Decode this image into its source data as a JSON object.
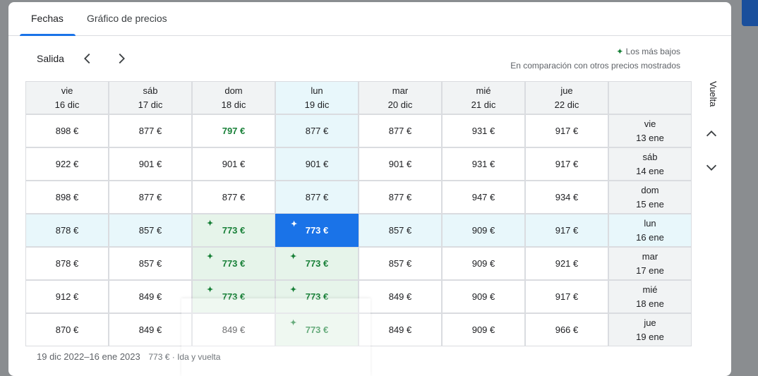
{
  "tabs": [
    {
      "label": "Fechas",
      "active": true
    },
    {
      "label": "Gráfico de precios",
      "active": false
    }
  ],
  "nav": {
    "salida_label": "Salida"
  },
  "legend": {
    "spark": "✦",
    "lowest_label": "Los más bajos",
    "comparison_text": "En comparación con otros precios mostrados"
  },
  "vuelta_label": "Vuelta",
  "columns": [
    {
      "day": "vie",
      "date": "16 dic"
    },
    {
      "day": "sáb",
      "date": "17 dic"
    },
    {
      "day": "dom",
      "date": "18 dic"
    },
    {
      "day": "lun",
      "date": "19 dic"
    },
    {
      "day": "mar",
      "date": "20 dic"
    },
    {
      "day": "mié",
      "date": "21 dic"
    },
    {
      "day": "jue",
      "date": "22 dic"
    }
  ],
  "rows": [
    {
      "day": "vie",
      "date": "13 ene",
      "prices": [
        "898 €",
        "877 €",
        "797 €",
        "877 €",
        "877 €",
        "931 €",
        "917 €"
      ]
    },
    {
      "day": "sáb",
      "date": "14 ene",
      "prices": [
        "922 €",
        "901 €",
        "901 €",
        "901 €",
        "901 €",
        "931 €",
        "917 €"
      ]
    },
    {
      "day": "dom",
      "date": "15 ene",
      "prices": [
        "898 €",
        "877 €",
        "877 €",
        "877 €",
        "877 €",
        "947 €",
        "934 €"
      ]
    },
    {
      "day": "lun",
      "date": "16 ene",
      "prices": [
        "878 €",
        "857 €",
        "773 €",
        "773 €",
        "857 €",
        "909 €",
        "917 €"
      ]
    },
    {
      "day": "mar",
      "date": "17 ene",
      "prices": [
        "878 €",
        "857 €",
        "773 €",
        "773 €",
        "857 €",
        "909 €",
        "921 €"
      ]
    },
    {
      "day": "mié",
      "date": "18 ene",
      "prices": [
        "912 €",
        "849 €",
        "773 €",
        "773 €",
        "849 €",
        "909 €",
        "917 €"
      ]
    },
    {
      "day": "jue",
      "date": "19 ene",
      "prices": [
        "870 €",
        "849 €",
        "849 €",
        "773 €",
        "849 €",
        "909 €",
        "966 €"
      ]
    }
  ],
  "selected_column": 3,
  "selected_row": 3,
  "low_cells": [
    [
      3,
      2
    ],
    [
      4,
      2
    ],
    [
      4,
      3
    ],
    [
      5,
      2
    ],
    [
      5,
      3
    ],
    [
      6,
      3
    ]
  ],
  "low_text_only": [
    [
      0,
      2
    ]
  ],
  "footer": {
    "dates": "19 dic 2022–16 ene 2023",
    "price_note": "773 € · Ida y vuelta"
  },
  "colors": {
    "accent": "#1a73e8",
    "low_green": "#188038",
    "low_bg": "#e6f4ea",
    "highlight_bg": "#e8f7fb"
  }
}
